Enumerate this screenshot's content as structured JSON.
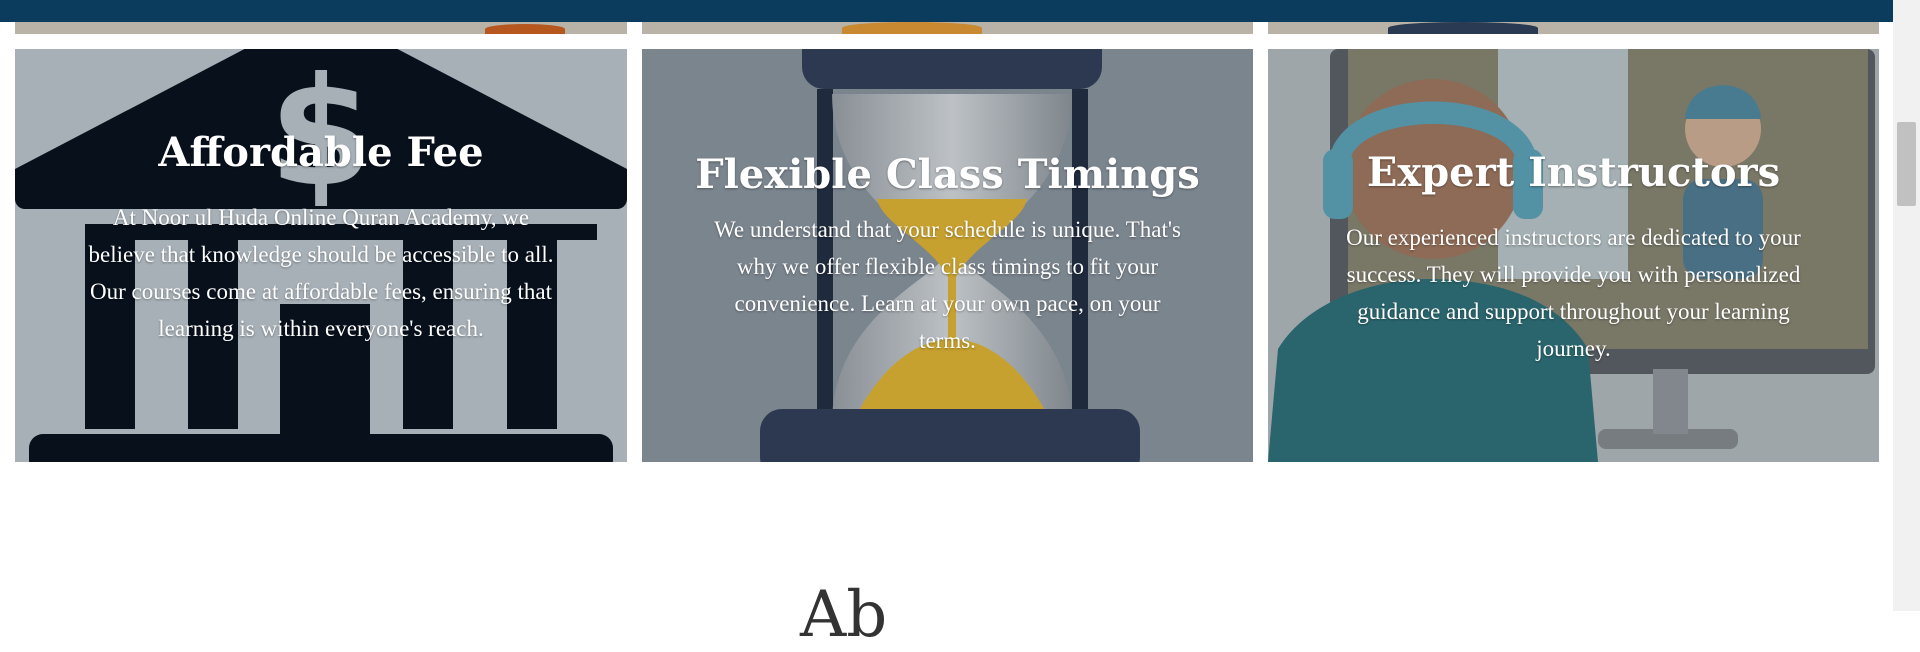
{
  "cards": [
    {
      "title": "Affordable Fee",
      "text": "At Noor ul Huda Online Quran Academy, we believe that knowledge should be accessible to all. Our courses come at affordable fees, ensuring that learning is within everyone's reach.",
      "image": "bank-icon"
    },
    {
      "title": "Flexible Class Timings",
      "text": "We understand that your schedule is unique. That's why we offer flexible class timings to fit your convenience. Learn at your own pace, on your terms.",
      "image": "hourglass-icon"
    },
    {
      "title": "Expert Instructors",
      "text": "Our experienced instructors are dedicated to your success. They will provide you with personalized guidance and support throughout your learning journey.",
      "image": "online-teacher-illustration"
    }
  ],
  "next_section": {
    "heading_partial": "Ab"
  },
  "colors": {
    "header_band": "#0b3c5d",
    "card_overlay": "#7b858e",
    "bank_icon": "#08101c",
    "text": "#ffffff"
  }
}
